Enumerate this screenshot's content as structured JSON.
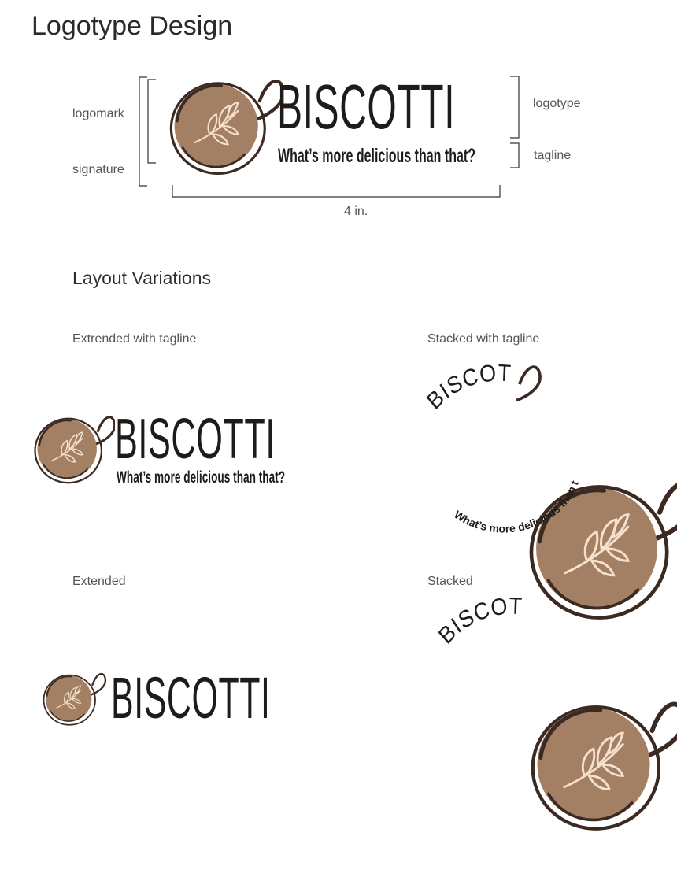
{
  "page": {
    "title": "Logotype Design",
    "section_title": "Layout Variations"
  },
  "anatomy": {
    "logomark_label": "logomark",
    "signature_label": "signature",
    "logotype_label": "logotype",
    "tagline_label": "tagline",
    "width_label": "4 in."
  },
  "brand": {
    "name": "BISCOTTI",
    "tagline": "What’s more delicious than that?"
  },
  "variations": [
    {
      "caption": "Extrended with tagline"
    },
    {
      "caption": "Stacked with tagline"
    },
    {
      "caption": "Extended"
    },
    {
      "caption": "Stacked"
    }
  ],
  "colors": {
    "coffee": "#a37f63",
    "outline": "#3a2a22",
    "leaf": "#f4e0cc",
    "ink": "#1f1b18"
  },
  "icons": {
    "logomark": "coffee-cup-with-leaf-icon"
  }
}
